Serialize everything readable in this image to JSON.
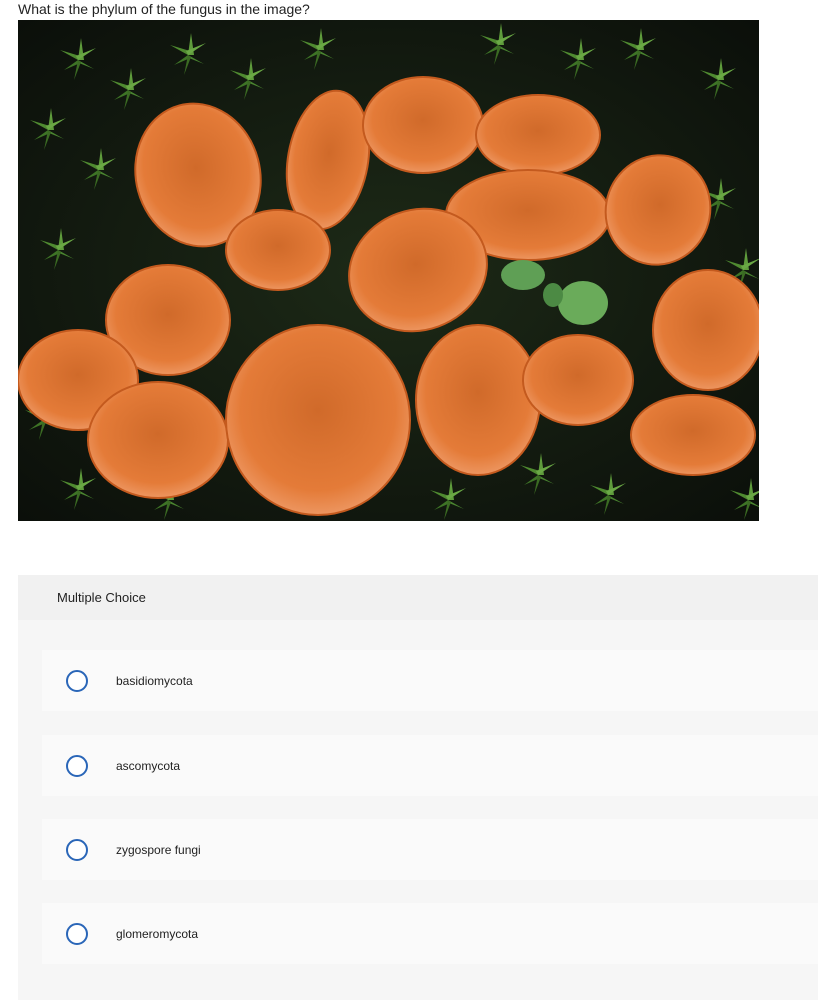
{
  "question": {
    "text": "What is the phylum of the fungus in the image?"
  },
  "image": {
    "subject": "cluster of orange cup fungi among green moss"
  },
  "multiple_choice": {
    "header": "Multiple Choice",
    "options": [
      {
        "label": "basidiomycota"
      },
      {
        "label": "ascomycota"
      },
      {
        "label": "zygospore fungi"
      },
      {
        "label": "glomeromycota"
      }
    ]
  },
  "colors": {
    "radio_border": "#2a66b8",
    "fungus_orange": "#e27a37",
    "moss_green": "#3f7a2a"
  }
}
